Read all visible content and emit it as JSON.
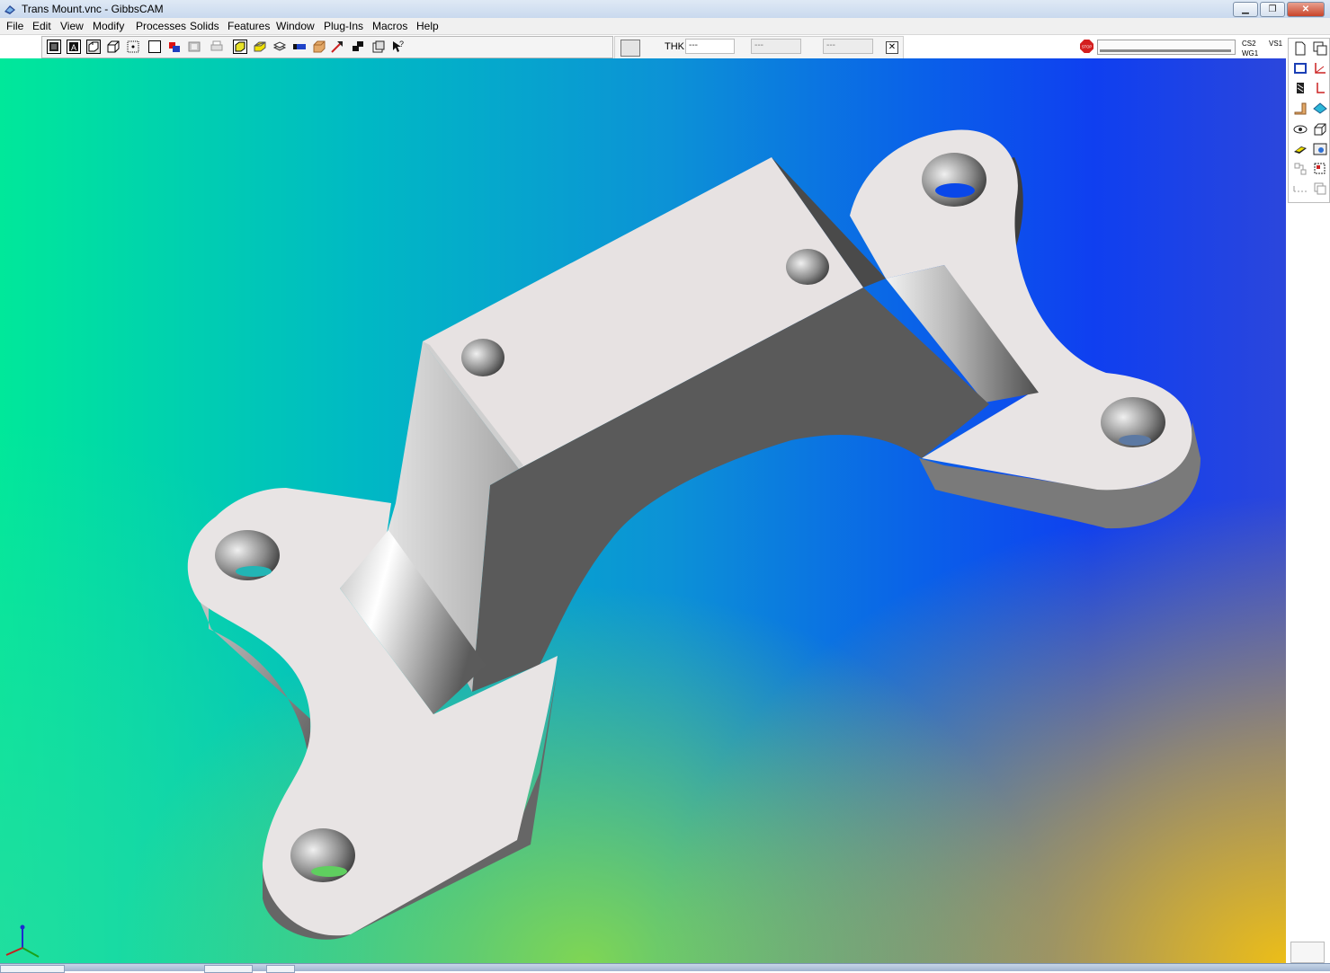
{
  "window": {
    "title": "Trans Mount.vnc - GibbsCAM",
    "buttons": [
      "minimize-icon",
      "maximize-icon",
      "close-icon"
    ]
  },
  "menu": {
    "items": [
      "File",
      "Edit",
      "View",
      "Modify",
      "Processes",
      "Solids",
      "Features",
      "Window",
      "Plug-Ins",
      "Macros",
      "Help"
    ]
  },
  "toolbar": {
    "icons": [
      "wireframe-view-icon",
      "shaded-view-icon",
      "hidden-line-icon",
      "box-view-icon",
      "point-icon",
      "blank-frame-icon",
      "flag-icon",
      "copy-shape-icon",
      "print-shape-icon",
      "solid-select-icon",
      "yellow-solid-icon",
      "stack-icon",
      "magnet-icon",
      "block-stock-icon",
      "arrow-pick-icon",
      "move-icon",
      "book-icon",
      "help-cursor-icon"
    ],
    "thk": {
      "label": "THK",
      "field1": "---",
      "field2": "---",
      "field3": "---"
    }
  },
  "status": {
    "stop_label": "STOP",
    "cs": "CS2",
    "vs": "VS1",
    "wg": "WG1"
  },
  "palette": {
    "icons": [
      "new-doc-icon",
      "windows-icon",
      "rect-select-icon",
      "axis-icon",
      "hatch-icon",
      "axis-red-icon",
      "fold-icon",
      "tilted-plane-icon",
      "eye-icon",
      "cube-icon",
      "eraser-icon",
      "photo-icon",
      "tree-icon",
      "tree-frame-icon",
      "dashed-line-icon",
      "copy-pages-icon"
    ]
  },
  "colors": {
    "part_face": "#e8e4e4",
    "part_shadow": "#595959",
    "accent_yellow": "#f6c40e"
  }
}
